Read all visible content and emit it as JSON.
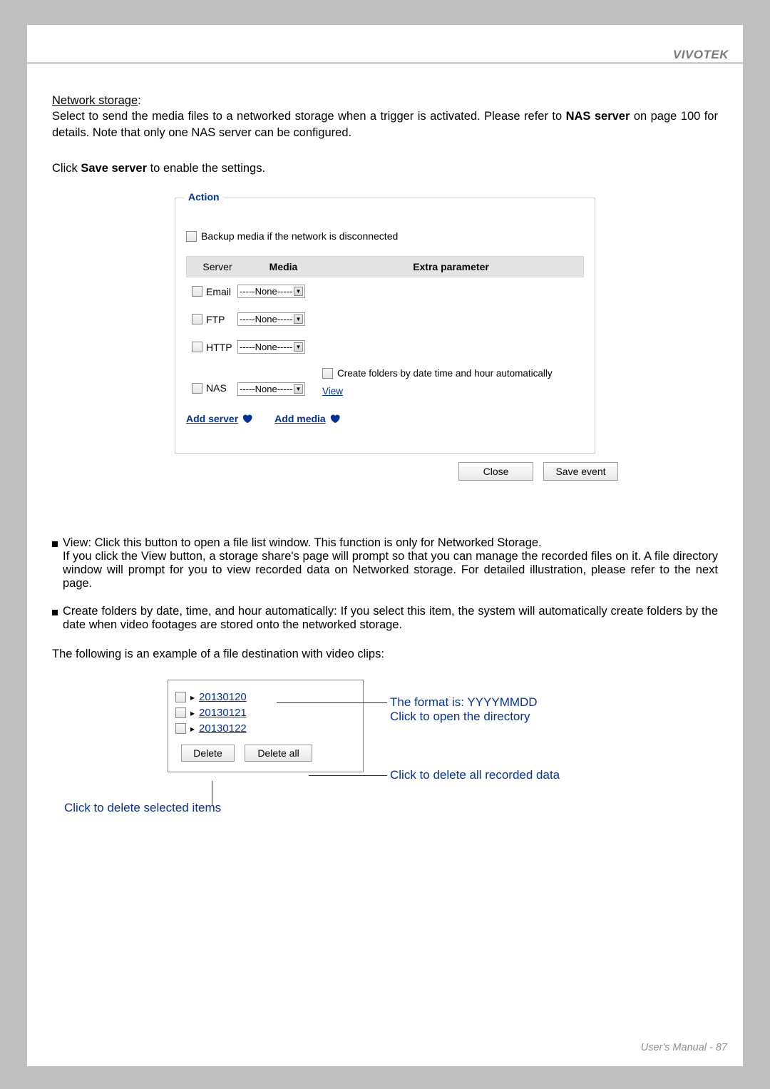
{
  "header": {
    "brand": "VIVOTEK"
  },
  "intro": {
    "section_title": "Network storage",
    "line1a": "Select to send the media files to a networked storage when a trigger is activated. Please refer to ",
    "line1b": "NAS server",
    "line1c": " on page 100 for details. Note that only one NAS server can be configured.",
    "line2a": "Click ",
    "line2b": "Save server",
    "line2c": " to enable the settings."
  },
  "action_panel": {
    "title": "Action",
    "backup_checkbox_label": "Backup media if the network is disconnected",
    "headers": {
      "server": "Server",
      "media": "Media",
      "extra": "Extra parameter"
    },
    "dropdown_placeholder": "-----None-----",
    "rows": [
      {
        "name": "Email"
      },
      {
        "name": "FTP"
      },
      {
        "name": "HTTP"
      },
      {
        "name": "NAS",
        "has_extra": true
      }
    ],
    "nas_extra_label": "Create folders by date time and hour automatically",
    "view_link": "View",
    "add_server": "Add server",
    "add_media": "Add media",
    "close_btn": "Close",
    "save_btn": "Save event"
  },
  "bullets": {
    "view_head": "View: Click this button to open a file list window. This function is only for Networked Storage.",
    "view_body": "If you click the View button, a storage share's page will prompt so that you can manage the recorded files on it. A file directory window will prompt for you to view recorded data on Networked storage. For detailed illustration, please refer to the next page.",
    "folders": "Create folders by date, time, and hour automatically: If you select this item, the system will automatically create folders by the date when video footages are stored onto the networked storage."
  },
  "example_intro": "The following is an example of a file destination with video clips:",
  "example": {
    "folders": [
      "20130120",
      "20130121",
      "20130122"
    ],
    "delete_btn": "Delete",
    "delete_all_btn": "Delete all",
    "ann_format": "The format is: YYYYMMDD",
    "ann_open": "Click to open the directory",
    "ann_delete_all": "Click to delete all recorded data",
    "ann_delete_sel": "Click to delete selected items"
  },
  "footer": {
    "text": "User's Manual - 87"
  }
}
